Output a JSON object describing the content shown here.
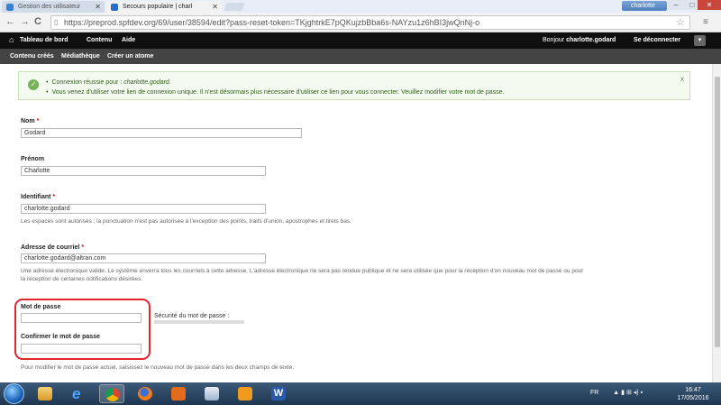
{
  "browser": {
    "tabs": [
      {
        "title": "Gestion des utilisateur",
        "close": "✕"
      },
      {
        "title": "Secours populaire | charl",
        "close": "✕"
      }
    ],
    "profile_name": "charlotte",
    "window_buttons": {
      "minimize": "–",
      "maximize": "□",
      "close": "✕"
    },
    "nav": {
      "back": "←",
      "forward": "→",
      "reload": "C"
    },
    "url": "https://preprod.spfdev.org/69/user/38594/edit?pass-reset-token=TKjghtrkE7pQKujzbBba6s-NAYzu1z6hBI3jwQnNj-o",
    "bookmark_star": "☆",
    "menu": "≡"
  },
  "toolbar": {
    "home_icon": "⌂",
    "items": [
      "Tableau de bord",
      "Contenu",
      "Aide"
    ],
    "greeting": "Bonjour",
    "username": "charlotte.godard",
    "logout": "Se déconnecter",
    "toggle": "▼"
  },
  "shortcuts": [
    "Contenu créés",
    "Médiathèque",
    "Créer un atome"
  ],
  "status_message": {
    "icon": "✓",
    "line1_prefix": "Connexion réussie pour :",
    "line1_user": "charlotte.godard.",
    "line2": "Vous venez d'utiliser votre lien de connexion unique. Il n'est désormais plus nécessaire d'utiliser ce lien pour vous connecter. Veuillez modifier votre mot de passe.",
    "close": "x"
  },
  "form": {
    "nom": {
      "label": "Nom",
      "required": "*",
      "value": "Godard"
    },
    "prenom": {
      "label": "Prénom",
      "value": "Charlotte"
    },
    "identifiant": {
      "label": "Identifiant",
      "required": "*",
      "value": "charlotte.godard",
      "help": "Les espaces sont autorisés ; la ponctuation n'est pas autorisée à l'exception des points, traits d'union, apostrophes et tirets bas."
    },
    "email": {
      "label": "Adresse de courriel",
      "required": "*",
      "value": "charlotte.godard@altran.com",
      "help_line1": "Une adresse électronique valide. Le système enverra tous les courriels à cette adresse. L'adresse électronique ne sera pas rendue publique et ne sera utilisée que pour la réception d'un nouveau mot de passe ou pour",
      "help_line2": "la réception de certaines notifications désirées."
    },
    "password": {
      "label": "Mot de passe",
      "value": ""
    },
    "password_confirm": {
      "label": "Confirmer le mot de passe",
      "value": ""
    },
    "strength_label": "Sécurité du mot de passe :",
    "password_help": "Pour modifier le mot de passe actuel, saisissez le nouveau mot de passe dans les deux champs de texte."
  },
  "taskbar": {
    "apps": [
      "windows-explorer",
      "internet-explorer",
      "chrome",
      "firefox",
      "media-player",
      "system-tool",
      "outlook",
      "word"
    ],
    "language": "FR",
    "tray_icons": "▲ ▮ ⊞ ◂) ▪",
    "time": "16:47",
    "date": "17/05/2016"
  }
}
